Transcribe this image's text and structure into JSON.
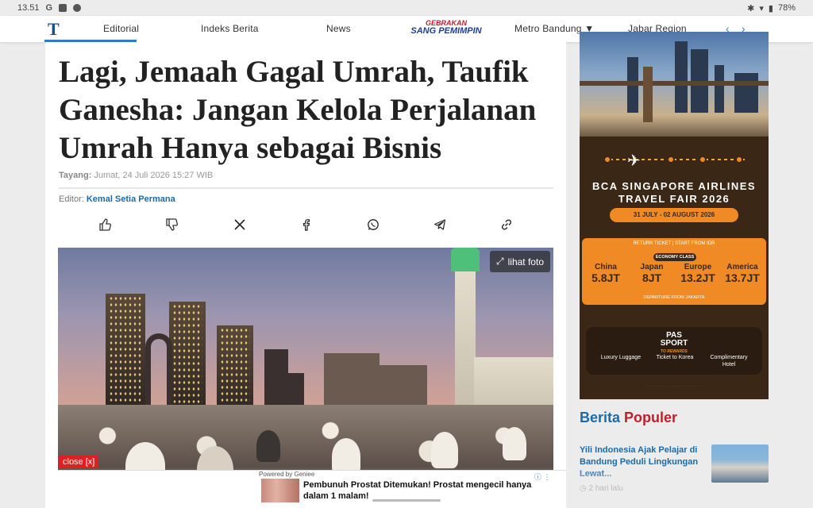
{
  "statusbar": {
    "time": "13.51",
    "battery": "78%"
  },
  "nav": {
    "logo": "T",
    "items": [
      "Editorial",
      "Indeks Berita",
      "News",
      "Metro Bandung",
      "Jabar Region"
    ],
    "brand_line1": "GEBRAKAN",
    "brand_line2": "SANG PEMIMPIN",
    "prev": "‹",
    "next": "›"
  },
  "article": {
    "headline": "Lagi, Jemaah Gagal Umrah, Taufik Ganesha: Jangan Kelola Perjalanan Umrah Hanya sebagai Bisnis",
    "tayang_label": "Tayang:",
    "tayang_date": "Jumat, 24 Juli 2026 15:27 WIB",
    "editor_label": "Editor:",
    "editor_name": "Kemal Setia Permana",
    "lihat_foto": "lihat foto",
    "share_icons": [
      "thumbs-up-icon",
      "thumbs-down-icon",
      "x-icon",
      "facebook-icon",
      "whatsapp-icon",
      "telegram-icon",
      "link-icon"
    ]
  },
  "ad_bottom": {
    "close": "close [x]",
    "powered": "Powered by Geniee",
    "text": "Pembunuh Prostat Ditemukan! Prostat mengecil hanya dalam 1 malam!"
  },
  "sidebar_ad": {
    "title_line1": "BCA SINGAPORE AIRLINES",
    "title_line2": "TRAVEL FAIR 2026",
    "date": "31 JULY - 02 AUGUST 2026",
    "return_ticket": "RETURN TICKET | START FROM IDR",
    "economy": "ECONOMY CLASS",
    "prices": [
      {
        "dest": "China",
        "value": "5.8JT"
      },
      {
        "dest": "Japan",
        "value": "8JT"
      },
      {
        "dest": "Europe",
        "value": "13.2JT"
      },
      {
        "dest": "America",
        "value": "13.7JT"
      }
    ],
    "departure": "DEPARTURE FROM JAKARTA",
    "passport_line1": "PAS",
    "passport_line2": "SPORT",
    "passport_sub": "TO REWARDS",
    "features": [
      "Luxury Luggage",
      "Ticket to Korea",
      "Complimentary Hotel"
    ]
  },
  "popular": {
    "title_blue": "Berita",
    "title_red": "Populer",
    "items": [
      {
        "title": "Yili Indonesia Ajak Pelajar di Bandung Peduli Lingkungan Lewat...",
        "time": "2 hari lalu"
      }
    ]
  }
}
